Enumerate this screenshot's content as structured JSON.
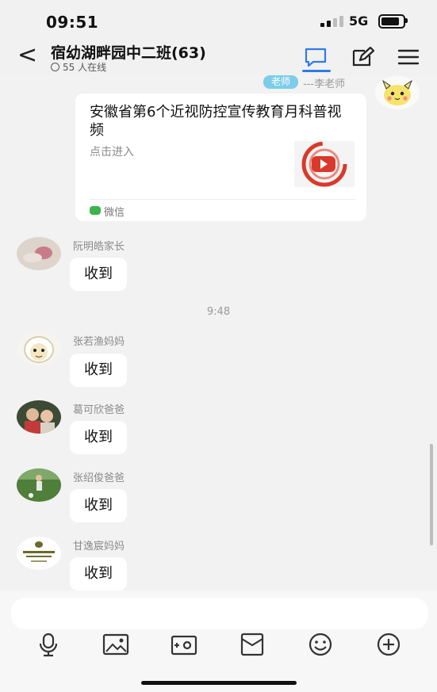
{
  "status_bar": {
    "time": "09:51",
    "network": "5G",
    "signal_level": "2 of 4 bars",
    "battery_level": 0.85
  },
  "header": {
    "back_glyph": "<",
    "title": "宿幼湖畔园中二班(63)",
    "online": "55 人在线"
  },
  "messages": {
    "teacher_tag": "老师",
    "teacher_name": "---李老师",
    "card": {
      "title": "安徽省第6个近视防控宣传教育月科普视频",
      "subtitle": "点击进入",
      "source": "微信"
    },
    "m1": {
      "name": "阮明皓家长",
      "text": "收到"
    },
    "time_divider": "9:48",
    "m2": {
      "name": "张若渔妈妈",
      "text": "收到"
    },
    "m3": {
      "name": "葛可欣爸爸",
      "text": "收到"
    },
    "m4": {
      "name": "张绍俊爸爸",
      "text": "收到"
    },
    "m5": {
      "name": "甘逸宸妈妈",
      "text": "收到"
    }
  },
  "input": {
    "placeholder": ""
  },
  "icons": [
    "back-icon",
    "chat-icon",
    "edit-icon",
    "menu-icon",
    "voice-icon",
    "image-icon",
    "camera-icon",
    "red-packet-icon",
    "emoji-icon",
    "plus-icon",
    "play-icon"
  ],
  "colors": {
    "accent": "#2f7bea",
    "teacher_tag_bg": "#7dcdea",
    "wechat_green": "#3bb54a",
    "play_red": "#d9392b"
  }
}
